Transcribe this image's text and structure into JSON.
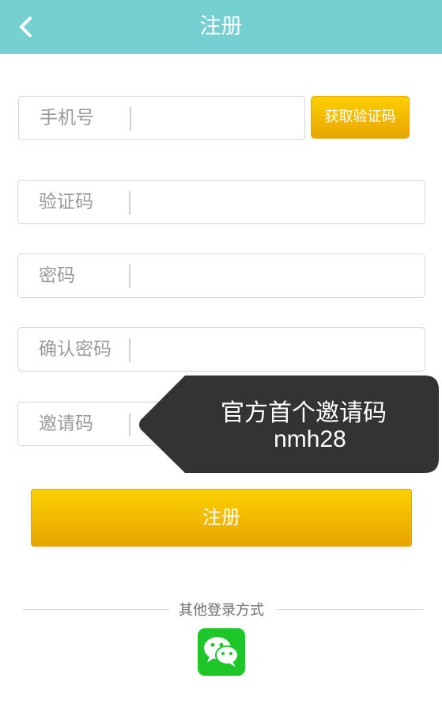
{
  "header": {
    "title": "注册",
    "back_icon": "chevron-left-icon"
  },
  "form": {
    "phone_label": "手机号",
    "get_code_label": "获取验证码",
    "code_label": "验证码",
    "password_label": "密码",
    "confirm_password_label": "确认密码",
    "invite_code_label": "邀请码"
  },
  "tooltip": {
    "line1": "官方首个邀请码",
    "line2": "nmh28"
  },
  "register_label": "注册",
  "other_login": {
    "label": "其他登录方式",
    "wechat_icon": "wechat-icon"
  },
  "colors": {
    "header": "#76cfd0",
    "accent": "#f5c400",
    "tooltip": "#333333",
    "wechat": "#1dc72a"
  }
}
